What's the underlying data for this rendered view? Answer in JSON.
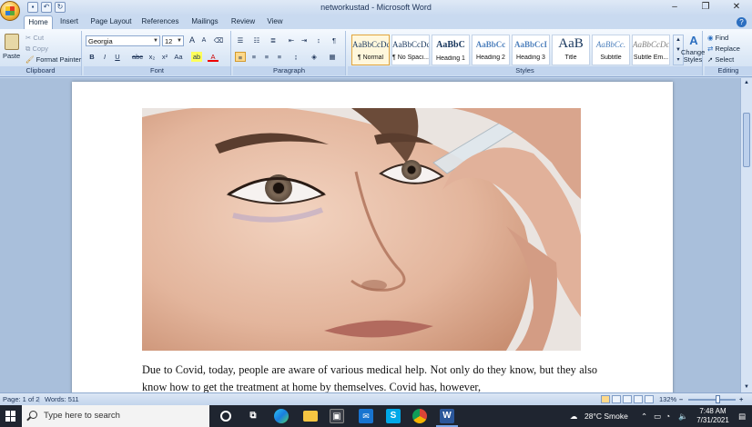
{
  "window": {
    "title": "networkustad - Microsoft Word",
    "minimize": "–",
    "maximize": "❐",
    "close": "✕"
  },
  "tabs": [
    "Home",
    "Insert",
    "Page Layout",
    "References",
    "Mailings",
    "Review",
    "View"
  ],
  "clipboard": {
    "label": "Clipboard",
    "paste": "Paste",
    "cut": "Cut",
    "copy": "Copy",
    "format_painter": "Format Painter"
  },
  "font": {
    "label": "Font",
    "family": "Georgia",
    "size": "12",
    "bold": "B",
    "italic": "I",
    "underline": "U",
    "strike": "abc",
    "subscript": "x₂",
    "superscript": "x²",
    "change_case": "Aa",
    "grow": "A",
    "shrink": "A",
    "clear": "⌫"
  },
  "paragraph": {
    "label": "Paragraph",
    "pilcrow": "¶"
  },
  "styles": {
    "label": "Styles",
    "items": [
      {
        "sample": "AaBbCcDc",
        "name": "¶ Normal"
      },
      {
        "sample": "AaBbCcDc",
        "name": "¶ No Spaci..."
      },
      {
        "sample": "AaBbC",
        "name": "Heading 1"
      },
      {
        "sample": "AaBbCc",
        "name": "Heading 2"
      },
      {
        "sample": "AaBbCcI",
        "name": "Heading 3"
      },
      {
        "sample": "AaB",
        "name": "Title"
      },
      {
        "sample": "AaBbCc.",
        "name": "Subtitle"
      },
      {
        "sample": "AaBbCcDc",
        "name": "Subtle Em..."
      }
    ],
    "change_styles": "Change Styles"
  },
  "editing": {
    "label": "Editing",
    "find": "Find",
    "replace": "Replace",
    "select": "Select"
  },
  "document": {
    "paragraph": "Due to Covid, today, people are aware of various medical help. Not only do they know, but they also know how to get the treatment at home by themselves. Covid has, however,"
  },
  "status": {
    "page": "Page: 1 of 2",
    "words": "Words: 511",
    "zoom": "132%",
    "zoom_minus": "–",
    "zoom_plus": "+"
  },
  "taskbar": {
    "search_placeholder": "Type here to search",
    "weather": "28°C  Smoke",
    "time": "7:48 AM",
    "date": "7/31/2021"
  },
  "colors": {
    "ribbon": "#dce8f6",
    "taskbar": "#1f2530",
    "accent": "#2c6fc0"
  }
}
